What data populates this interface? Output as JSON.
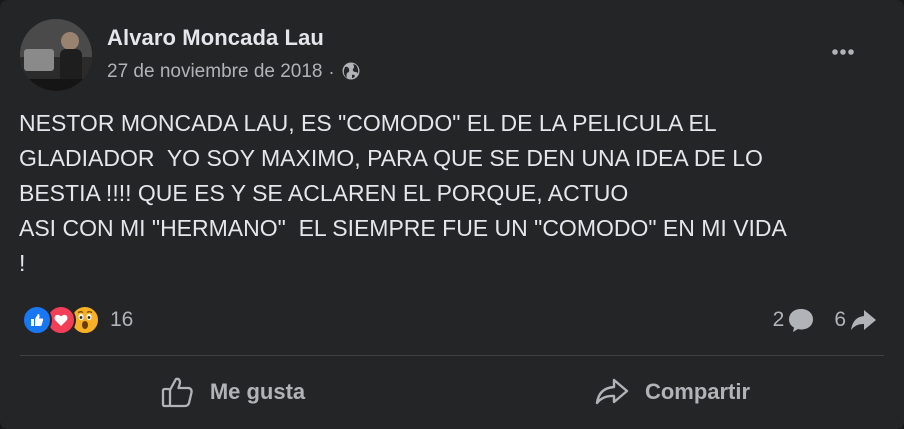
{
  "post": {
    "author": "Alvaro Moncada Lau",
    "date": "27 de noviembre de 2018",
    "separator": "·",
    "privacy_icon": "globe-icon",
    "text": "NESTOR MONCADA LAU, ES \"COMODO\" EL DE LA PELICULA EL\nGLADIADOR  YO SOY MAXIMO, PARA QUE SE DEN UNA IDEA DE LO\nBESTIA !!!! QUE ES Y SE ACLAREN EL PORQUE, ACTUO\nASI CON MI \"HERMANO\"  EL SIEMPRE FUE UN \"COMODO\" EN MI VIDA\n!"
  },
  "reactions": {
    "icons": [
      "like-reaction-icon",
      "love-reaction-icon",
      "wow-reaction-icon"
    ],
    "count": "16"
  },
  "stats": {
    "comments": "2",
    "shares": "6"
  },
  "actions": {
    "like_label": "Me gusta",
    "share_label": "Compartir"
  },
  "colors": {
    "card_bg": "#242526",
    "text_primary": "#e4e6eb",
    "text_secondary": "#b0b3b8",
    "like_blue": "#1877f2",
    "love_red": "#f33e58",
    "wow_yellow": "#f7b125"
  }
}
